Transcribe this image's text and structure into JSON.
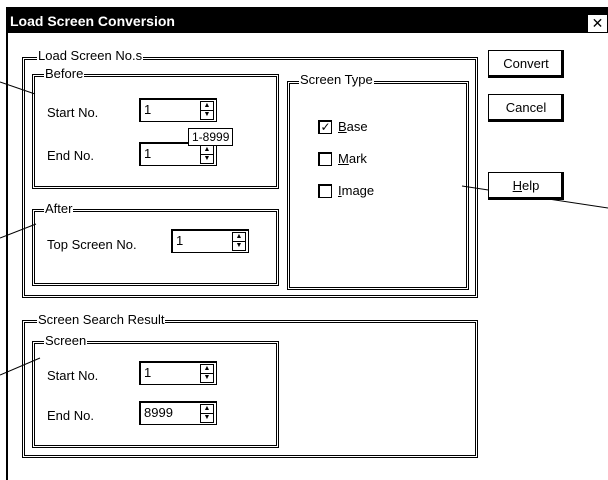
{
  "window": {
    "title": "Load Screen Conversion",
    "close_glyph": "✕"
  },
  "load_group": {
    "legend": "Load Screen No.s",
    "before": {
      "legend": "Before",
      "start_label": "Start No.",
      "start_value": "1",
      "end_label": "End No.",
      "end_value": "1",
      "tooltip": "1-8999"
    },
    "after": {
      "legend": "After",
      "top_label": "Top Screen No.",
      "top_value": "1"
    },
    "screen_type": {
      "legend": "Screen Type",
      "options": [
        {
          "mnemonic": "B",
          "rest": "ase",
          "checked": true
        },
        {
          "mnemonic": "M",
          "rest": "ark",
          "checked": false
        },
        {
          "mnemonic": "I",
          "rest": "mage",
          "checked": false
        }
      ]
    }
  },
  "buttons": {
    "convert": "Convert",
    "cancel": "Cancel",
    "help_mnemonic": "H",
    "help_rest": "elp"
  },
  "result_group": {
    "legend": "Screen Search Result",
    "screen": {
      "legend": "Screen",
      "start_label": "Start No.",
      "start_value": "1",
      "end_label": "End No.",
      "end_value": "8999"
    }
  },
  "icons": {
    "check_mark": "✓",
    "spin_up": "▲",
    "spin_down": "▼"
  }
}
